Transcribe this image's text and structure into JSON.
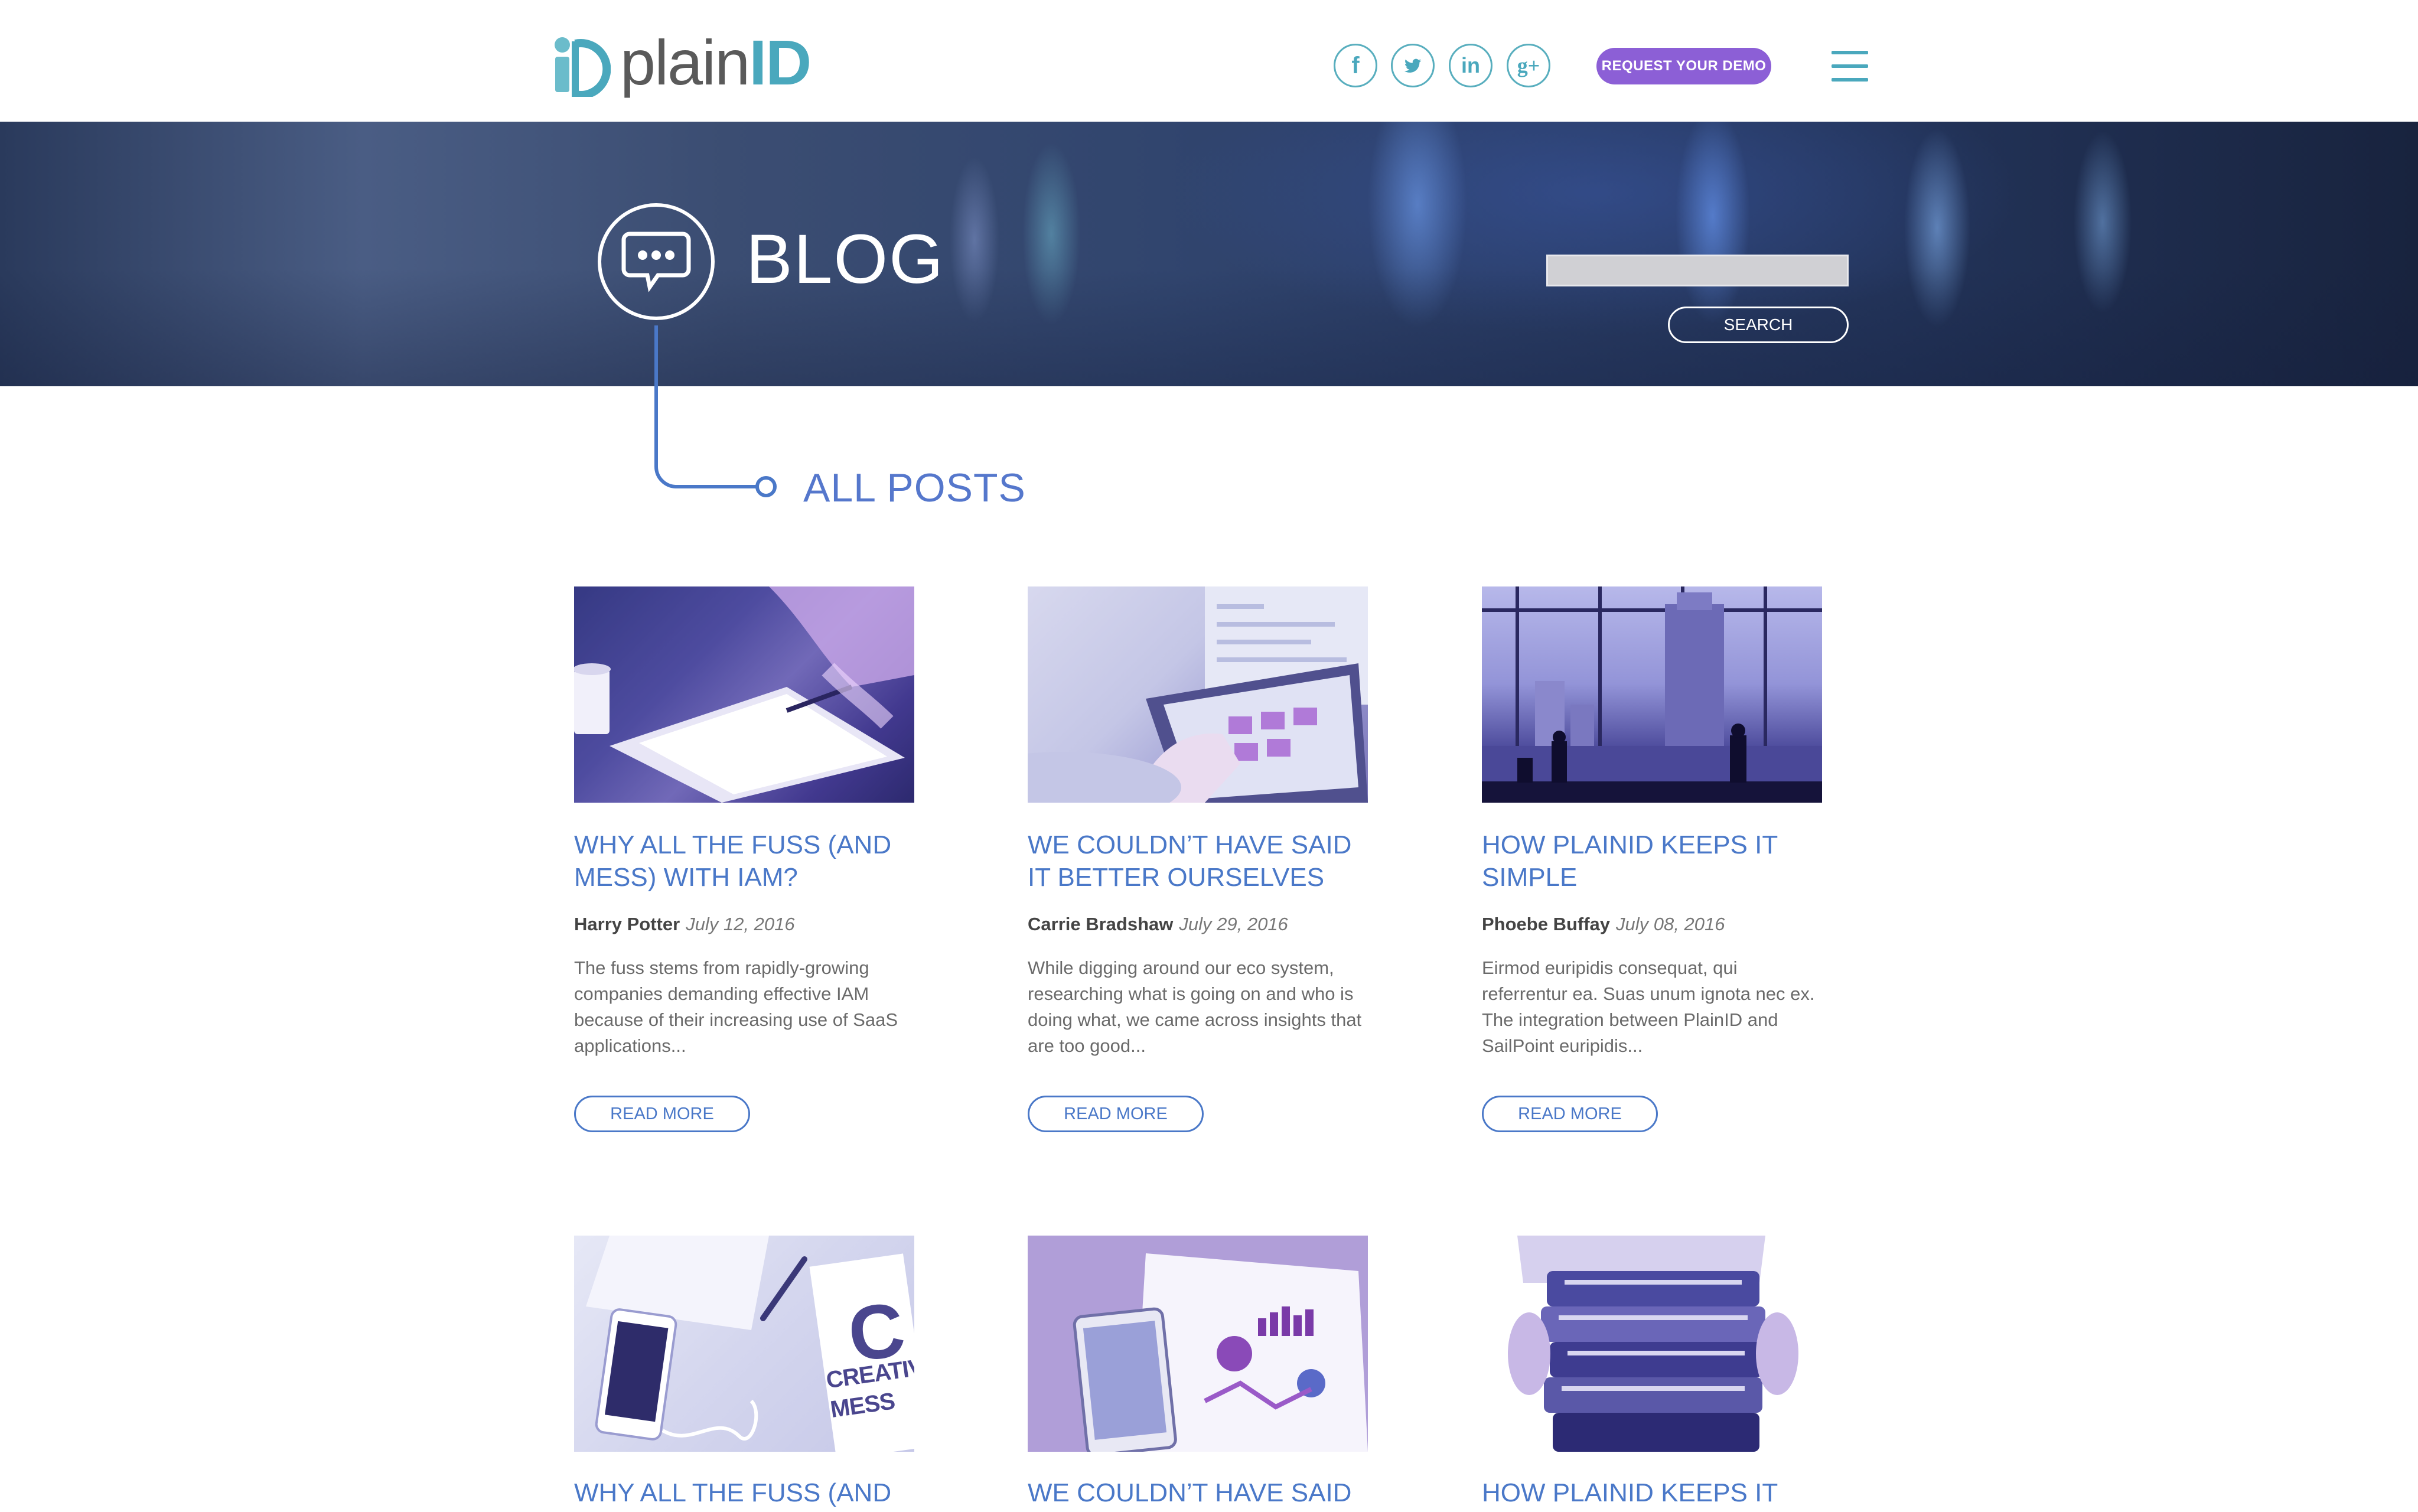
{
  "header": {
    "logo": {
      "word": "plain",
      "id": "ID"
    },
    "social": [
      {
        "name": "facebook-icon",
        "glyph": "f"
      },
      {
        "name": "twitter-icon",
        "glyph": "twitter"
      },
      {
        "name": "linkedin-icon",
        "glyph": "in"
      },
      {
        "name": "google-plus-icon",
        "glyph": "g+"
      }
    ],
    "demo_button": "REQUEST YOUR DEMO",
    "menu_icon": "hamburger-icon"
  },
  "hero": {
    "title": "BLOG",
    "icon": "chat-bubble-icon",
    "search_value": "",
    "search_button": "SEARCH"
  },
  "section": {
    "title": "ALL POSTS"
  },
  "colors": {
    "brand_teal": "#4aa8bd",
    "accent_purple": "#8c5fd6",
    "link_blue": "#4a78c8"
  },
  "posts": [
    {
      "title": "WHY ALL THE FUSS (AND MESS) WITH IAM?",
      "author": "Harry Potter",
      "date": "July 12, 2016",
      "excerpt": "The fuss stems from rapidly-growing companies demanding effective IAM because of their increasing use of SaaS applications...",
      "read_more": "READ MORE"
    },
    {
      "title": "WE COULDN’T HAVE SAID IT BETTER OURSELVES",
      "author": "Carrie Bradshaw",
      "date": "July 29, 2016",
      "excerpt": "While digging around our eco system, researching what is going on and who is doing what, we came across insights that are too good...",
      "read_more": "READ MORE"
    },
    {
      "title": "HOW PLAINID KEEPS IT SIMPLE",
      "author": "Phoebe Buffay",
      "date": "July 08, 2016",
      "excerpt": "Eirmod euripidis consequat, qui referrentur ea. Suas unum ignota nec ex. The integration between PlainID and SailPoint euripidis...",
      "read_more": "READ MORE"
    },
    {
      "title": "WHY ALL THE FUSS (AND",
      "image_text": "CREATIVE MESS"
    },
    {
      "title": "WE COULDN’T HAVE SAID IT"
    },
    {
      "title": "HOW PLAINID KEEPS IT"
    }
  ]
}
